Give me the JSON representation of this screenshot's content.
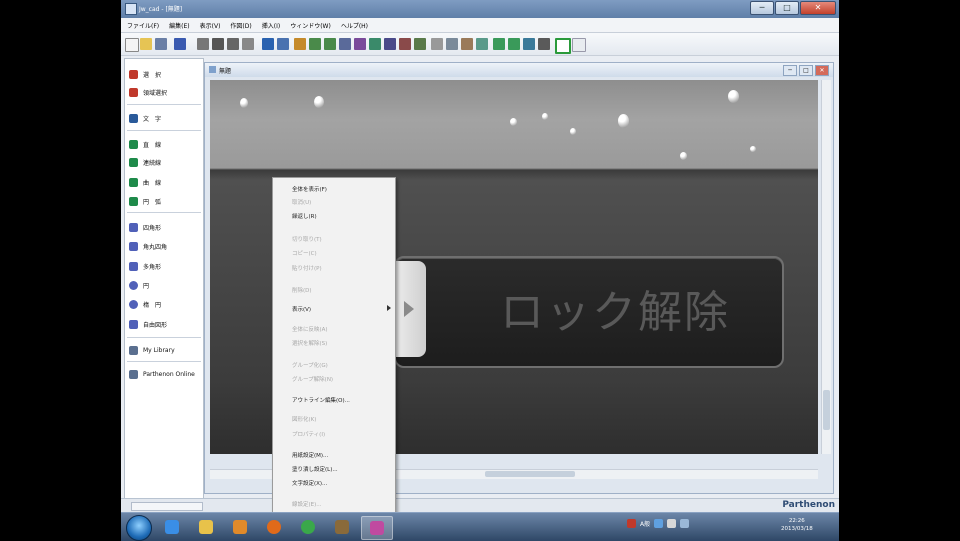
{
  "app": {
    "title": "Jw_cad - [無題]",
    "window_controls": [
      "─",
      "□",
      "✕"
    ]
  },
  "menu": [
    "ファイル(F)",
    "編集(E)",
    "表示(V)",
    "作図(D)",
    "挿入(I)",
    "ウィンドウ(W)",
    "ヘルプ(H)"
  ],
  "sidebar": {
    "items": [
      {
        "label": "選　択",
        "icon": "select-icon",
        "color": "#c0392b"
      },
      {
        "label": "領域選択",
        "icon": "area-select-icon",
        "color": "#c0392b"
      },
      {
        "label": "文　字",
        "icon": "text-icon",
        "color": "#2a5a9a"
      },
      {
        "label": "直　線",
        "icon": "line-icon",
        "color": "#1e8a4a"
      },
      {
        "label": "連続線",
        "icon": "polyline-icon",
        "color": "#1e8a4a"
      },
      {
        "label": "曲　線",
        "icon": "curve-icon",
        "color": "#1e8a4a"
      },
      {
        "label": "円　弧",
        "icon": "arc-icon",
        "color": "#1e8a4a"
      },
      {
        "label": "四角形",
        "icon": "rectangle-icon",
        "color": "#5060b8"
      },
      {
        "label": "角丸四角",
        "icon": "rounded-rect-icon",
        "color": "#5060b8"
      },
      {
        "label": "多角形",
        "icon": "polygon-icon",
        "color": "#5060b8"
      },
      {
        "label": "円",
        "icon": "circle-icon",
        "color": "#5060b8"
      },
      {
        "label": "楕　円",
        "icon": "ellipse-icon",
        "color": "#5060b8"
      },
      {
        "label": "自由図形",
        "icon": "freeform-icon",
        "color": "#5060b8"
      },
      {
        "label": "My Library",
        "icon": "library-icon",
        "color": "#5a6f8f"
      },
      {
        "label": "Parthenon Online",
        "icon": "online-icon",
        "color": "#5a6f8f"
      }
    ]
  },
  "document": {
    "title": "無題",
    "controls": [
      "─",
      "□",
      "✕"
    ]
  },
  "canvas": {
    "unlock_text": "ロック解除"
  },
  "context_menu": {
    "items": [
      {
        "label": "全体を表示(F)",
        "enabled": true
      },
      {
        "label": "取消(U)",
        "enabled": false
      },
      {
        "label": "繰返し(R)",
        "enabled": true
      },
      {
        "label": "切り取り(T)",
        "enabled": false
      },
      {
        "label": "コピー(C)",
        "enabled": false
      },
      {
        "label": "貼り付け(P)",
        "enabled": false
      },
      {
        "label": "削除(D)",
        "enabled": false
      },
      {
        "label": "表示(V)",
        "enabled": true,
        "submenu": true
      },
      {
        "label": "全体に反映(A)",
        "enabled": false
      },
      {
        "label": "選択を解除(S)",
        "enabled": false
      },
      {
        "label": "グループ化(G)",
        "enabled": false
      },
      {
        "label": "グループ解除(N)",
        "enabled": false
      },
      {
        "label": "アウトライン編集(O)...",
        "enabled": true
      },
      {
        "label": "図形化(K)",
        "enabled": false
      },
      {
        "label": "プロパティ(I)",
        "enabled": false
      },
      {
        "label": "用紙設定(M)...",
        "enabled": true
      },
      {
        "label": "塗り潰し設定(L)...",
        "enabled": true
      },
      {
        "label": "文字設定(X)...",
        "enabled": true
      },
      {
        "label": "線設定(E)...",
        "enabled": false
      }
    ]
  },
  "status": {
    "badge": "Parthenon"
  },
  "taskbar": {
    "apps": [
      {
        "name": "ie-icon",
        "color": "#3a8ee6"
      },
      {
        "name": "folder-icon",
        "color": "#e8c24a"
      },
      {
        "name": "media-player-icon",
        "color": "#e08a2a"
      },
      {
        "name": "firefox-icon",
        "color": "#e06a1a"
      },
      {
        "name": "chrome-icon",
        "color": "#3aa84a"
      },
      {
        "name": "app-icon",
        "color": "#8a6a3a"
      },
      {
        "name": "cad-icon",
        "color": "#c04aa0"
      }
    ],
    "tray_lang": "A般",
    "clock_time": "22:26",
    "clock_date": "2013/03/18"
  }
}
